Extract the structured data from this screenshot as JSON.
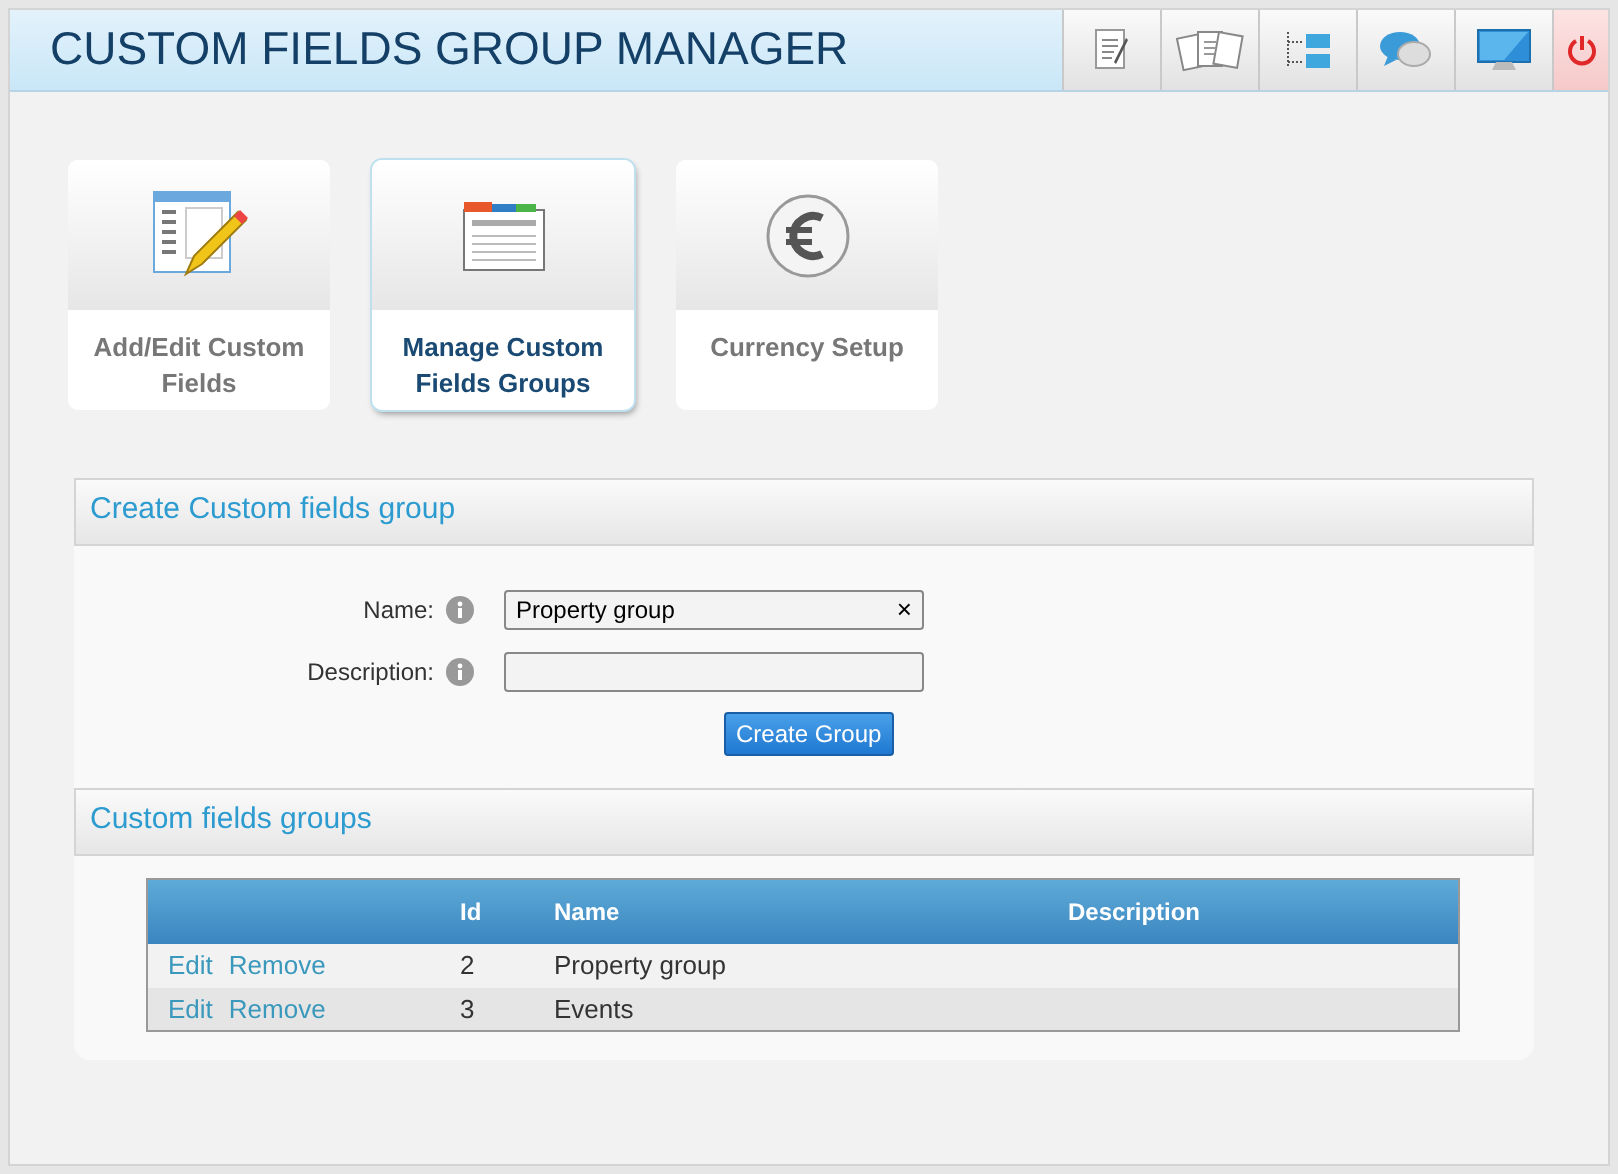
{
  "window": {
    "title": "CUSTOM FIELDS GROUP MANAGER"
  },
  "tiles": [
    {
      "label": "Add/Edit Custom Fields",
      "selected": false
    },
    {
      "label": "Manage Custom Fields Groups",
      "selected": true
    },
    {
      "label": "Currency Setup",
      "selected": false
    }
  ],
  "create_section": {
    "title": "Create Custom fields group",
    "fields": [
      {
        "label": "Name:",
        "value": "Property group",
        "clear_button": "×"
      },
      {
        "label": "Description:"
      }
    ],
    "button": "Create Group"
  },
  "groups_section": {
    "title": "Custom fields groups",
    "table": {
      "columns": [
        "Id",
        "Name",
        "Description"
      ],
      "rows": [
        {
          "actions": [
            "Edit",
            "Remove"
          ],
          "cells": [
            "2",
            "Property group",
            ""
          ]
        },
        {
          "actions": [
            "Edit",
            "Remove"
          ],
          "cells": [
            "3",
            "Events",
            ""
          ]
        }
      ]
    }
  }
}
